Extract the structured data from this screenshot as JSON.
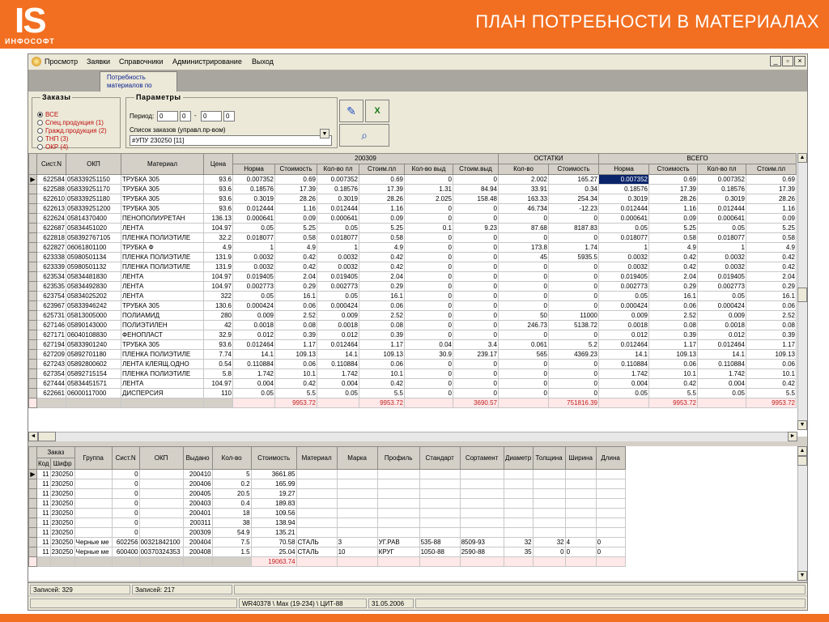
{
  "header": {
    "logo_mark": "IS",
    "logo_text": "ИНФОСОФТ",
    "title": "ПЛАН ПОТРЕБНОСТИ В МАТЕРИАЛАХ"
  },
  "menu": [
    "Просмотр",
    "Заявки",
    "Справочники",
    "Администрирование",
    "Выход"
  ],
  "window_buttons": [
    "_",
    "▫",
    "×"
  ],
  "tab": "Потребность материалов по",
  "orders": {
    "title": "Заказы",
    "options": [
      "ВСЕ",
      "Спец.продукция (1)",
      "Гражд.продукция (2)",
      "ТНП (3)",
      "ОКР (4)"
    ],
    "selected": 0
  },
  "params": {
    "title": "Параметры",
    "period_label": "Период:",
    "period_from": [
      "0",
      "0"
    ],
    "period_to": [
      "0",
      "0"
    ],
    "list_label": "Список заказов (управл.пр-вом)",
    "list_value": "#УПУ 230250 [11]"
  },
  "grid1": {
    "fixed_headers": [
      "Сист.N",
      "ОКП",
      "Материал",
      "Цена"
    ],
    "groups": [
      "200309",
      "ОСТАТКИ",
      "ВСЕГО"
    ],
    "sub_headers": [
      "Норма",
      "Стоимость",
      "Кол-во пл",
      "Стоим.пл",
      "Кол-во выд",
      "Стоим.выд",
      "Кол-во",
      "Стоимость",
      "Норма",
      "Стоимость",
      "Кол-во пл",
      "Стоим.пл"
    ],
    "rows": [
      [
        "622584",
        "058339251150",
        "ТРУБКА 305",
        "93.6",
        "0.007352",
        "0.69",
        "0.007352",
        "0.69",
        "0",
        "0",
        "2.002",
        "165.27",
        "0.007352",
        "0.69",
        "0.007352",
        "0.69"
      ],
      [
        "622588",
        "058339251170",
        "ТРУБКА 305",
        "93.6",
        "0.18576",
        "17.39",
        "0.18576",
        "17.39",
        "1.31",
        "84.94",
        "33.91",
        "0.34",
        "0.18576",
        "17.39",
        "0.18576",
        "17.39"
      ],
      [
        "622610",
        "058339251180",
        "ТРУБКА 305",
        "93.6",
        "0.3019",
        "28.26",
        "0.3019",
        "28.26",
        "2.025",
        "158.48",
        "163.33",
        "254.34",
        "0.3019",
        "28.26",
        "0.3019",
        "28.26"
      ],
      [
        "622613",
        "058339251200",
        "ТРУБКА 305",
        "93.6",
        "0.012444",
        "1.16",
        "0.012444",
        "1.16",
        "0",
        "0",
        "46.734",
        "-12.23",
        "0.012444",
        "1.16",
        "0.012444",
        "1.16"
      ],
      [
        "622624",
        "05814370400",
        "ПЕНОПОЛИУРЕТАН",
        "136.13",
        "0.000641",
        "0.09",
        "0.000641",
        "0.09",
        "0",
        "0",
        "0",
        "0",
        "0.000641",
        "0.09",
        "0.000641",
        "0.09"
      ],
      [
        "622687",
        "05834451020",
        "ЛЕНТА",
        "104.97",
        "0.05",
        "5.25",
        "0.05",
        "5.25",
        "0.1",
        "9.23",
        "87.68",
        "8187.83",
        "0.05",
        "5.25",
        "0.05",
        "5.25"
      ],
      [
        "622818",
        "058392767105",
        "ПЛЕНКА ПОЛИЭТИЛЕ",
        "32.2",
        "0.018077",
        "0.58",
        "0.018077",
        "0.58",
        "0",
        "0",
        "0",
        "0",
        "0.018077",
        "0.58",
        "0.018077",
        "0.58"
      ],
      [
        "622827",
        "06061801100",
        "ТРУБКА Ф",
        "4.9",
        "1",
        "4.9",
        "1",
        "4.9",
        "0",
        "0",
        "173.8",
        "1.74",
        "1",
        "4.9",
        "1",
        "4.9"
      ],
      [
        "623338",
        "05980501134",
        "ПЛЕНКА ПОЛИЭТИЛЕ",
        "131.9",
        "0.0032",
        "0.42",
        "0.0032",
        "0.42",
        "0",
        "0",
        "45",
        "5935.5",
        "0.0032",
        "0.42",
        "0.0032",
        "0.42"
      ],
      [
        "623339",
        "05980501132",
        "ПЛЕНКА ПОЛИЭТИЛЕ",
        "131.9",
        "0.0032",
        "0.42",
        "0.0032",
        "0.42",
        "0",
        "0",
        "0",
        "0",
        "0.0032",
        "0.42",
        "0.0032",
        "0.42"
      ],
      [
        "623534",
        "05834481830",
        "ЛЕНТА",
        "104.97",
        "0.019405",
        "2.04",
        "0.019405",
        "2.04",
        "0",
        "0",
        "0",
        "0",
        "0.019405",
        "2.04",
        "0.019405",
        "2.04"
      ],
      [
        "623535",
        "05834492830",
        "ЛЕНТА",
        "104.97",
        "0.002773",
        "0.29",
        "0.002773",
        "0.29",
        "0",
        "0",
        "0",
        "0",
        "0.002773",
        "0.29",
        "0.002773",
        "0.29"
      ],
      [
        "623754",
        "05834025202",
        "ЛЕНТА",
        "322",
        "0.05",
        "16.1",
        "0.05",
        "16.1",
        "0",
        "0",
        "0",
        "0",
        "0.05",
        "16.1",
        "0.05",
        "16.1"
      ],
      [
        "623967",
        "05833946242",
        "ТРУБКА 305",
        "130.6",
        "0.000424",
        "0.06",
        "0.000424",
        "0.06",
        "0",
        "0",
        "0",
        "0",
        "0.000424",
        "0.06",
        "0.000424",
        "0.06"
      ],
      [
        "625731",
        "05813005000",
        "ПОЛИАМИД",
        "280",
        "0.009",
        "2.52",
        "0.009",
        "2.52",
        "0",
        "0",
        "50",
        "11000",
        "0.009",
        "2.52",
        "0.009",
        "2.52"
      ],
      [
        "627146",
        "05890143000",
        "ПОЛИЭТИЛЕН",
        "42",
        "0.0018",
        "0.08",
        "0.0018",
        "0.08",
        "0",
        "0",
        "246.73",
        "5138.72",
        "0.0018",
        "0.08",
        "0.0018",
        "0.08"
      ],
      [
        "627171",
        "06040108830",
        "ФЕНОПЛАСТ",
        "32.9",
        "0.012",
        "0.39",
        "0.012",
        "0.39",
        "0",
        "0",
        "0",
        "0",
        "0.012",
        "0.39",
        "0.012",
        "0.39"
      ],
      [
        "627194",
        "05833901240",
        "ТРУБКА 305",
        "93.6",
        "0.012464",
        "1.17",
        "0.012464",
        "1.17",
        "0.04",
        "3.4",
        "0.061",
        "5.2",
        "0.012464",
        "1.17",
        "0.012464",
        "1.17"
      ],
      [
        "627209",
        "05892701180",
        "ПЛЕНКА ПОЛИЭТИЛЕ",
        "7.74",
        "14.1",
        "109.13",
        "14.1",
        "109.13",
        "30.9",
        "239.17",
        "565",
        "4369.23",
        "14.1",
        "109.13",
        "14.1",
        "109.13"
      ],
      [
        "627243",
        "05892800602",
        "ЛЕНТА КЛЕЯЩ.ОДНО",
        "0.54",
        "0.110884",
        "0.06",
        "0.110884",
        "0.06",
        "0",
        "0",
        "0",
        "0",
        "0.110884",
        "0.06",
        "0.110884",
        "0.06"
      ],
      [
        "627354",
        "05892715154",
        "ПЛЕНКА ПОЛИЭТИЛЕ",
        "5.8",
        "1.742",
        "10.1",
        "1.742",
        "10.1",
        "0",
        "0",
        "0",
        "0",
        "1.742",
        "10.1",
        "1.742",
        "10.1"
      ],
      [
        "627444",
        "05834451571",
        "ЛЕНТА",
        "104.97",
        "0.004",
        "0.42",
        "0.004",
        "0.42",
        "0",
        "0",
        "0",
        "0",
        "0.004",
        "0.42",
        "0.004",
        "0.42"
      ],
      [
        "622661",
        "06000117000",
        "ДИСПЕРСИЯ",
        "110",
        "0.05",
        "5.5",
        "0.05",
        "5.5",
        "0",
        "0",
        "0",
        "0",
        "0.05",
        "5.5",
        "0.05",
        "5.5"
      ]
    ],
    "totals": [
      "",
      "",
      "",
      "",
      "",
      "9953.72",
      "",
      "9953.72",
      "",
      "3690.57",
      "",
      "751816.39",
      "",
      "9953.72",
      "",
      "9953.72"
    ]
  },
  "grid2": {
    "headers": [
      "Заказ",
      "Группа",
      "Сист.N",
      "ОКП",
      "Выдано",
      "Кол-во",
      "Стоимость",
      "Материал",
      "Марка",
      "Профиль",
      "Стандарт",
      "Сортамент",
      "Диаметр",
      "Толщина",
      "Ширина",
      "Длина"
    ],
    "sub_headers": [
      "Код",
      "Шифр"
    ],
    "rows": [
      [
        "11",
        "230250",
        "",
        "0",
        "",
        "200410",
        "5",
        "3661.85",
        "",
        "",
        "",
        "",
        "",
        "",
        "",
        "",
        ""
      ],
      [
        "11",
        "230250",
        "",
        "0",
        "",
        "200406",
        "0.2",
        "165.99",
        "",
        "",
        "",
        "",
        "",
        "",
        "",
        "",
        ""
      ],
      [
        "11",
        "230250",
        "",
        "0",
        "",
        "200405",
        "20.5",
        "19.27",
        "",
        "",
        "",
        "",
        "",
        "",
        "",
        "",
        ""
      ],
      [
        "11",
        "230250",
        "",
        "0",
        "",
        "200403",
        "0.4",
        "189.83",
        "",
        "",
        "",
        "",
        "",
        "",
        "",
        "",
        ""
      ],
      [
        "11",
        "230250",
        "",
        "0",
        "",
        "200401",
        "18",
        "109.56",
        "",
        "",
        "",
        "",
        "",
        "",
        "",
        "",
        ""
      ],
      [
        "11",
        "230250",
        "",
        "0",
        "",
        "200311",
        "38",
        "138.94",
        "",
        "",
        "",
        "",
        "",
        "",
        "",
        "",
        ""
      ],
      [
        "11",
        "230250",
        "",
        "0",
        "",
        "200309",
        "54.9",
        "135.21",
        "",
        "",
        "",
        "",
        "",
        "",
        "",
        "",
        ""
      ],
      [
        "11",
        "230250",
        "Черные ме",
        "602256",
        "00321842100",
        "200404",
        "7.5",
        "70.58",
        "СТАЛЬ",
        "3",
        "УГ.РАВ",
        "535-88",
        "8509-93",
        "32",
        "32",
        "4",
        "0"
      ],
      [
        "11",
        "230250",
        "Черные ме",
        "600400",
        "00370324353",
        "200408",
        "1.5",
        "25.04",
        "СТАЛЬ",
        "10",
        "КРУГ",
        "1050-88",
        "2590-88",
        "35",
        "0",
        "0",
        "0"
      ]
    ],
    "total": "19063.74"
  },
  "status": {
    "records1": "Записей: 329",
    "records2": "Записей: 217",
    "user": "WR40378 \\ Max (19-234) \\ ЦИТ-88",
    "date": "31.05.2006"
  }
}
